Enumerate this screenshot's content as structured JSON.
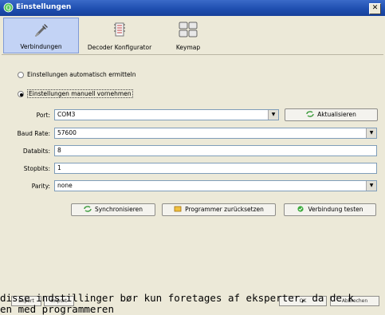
{
  "window": {
    "title": "Einstellungen",
    "close_glyph": "✕"
  },
  "toolbar": {
    "tabs": [
      {
        "label": "Verbindungen",
        "icon": "plug-icon",
        "active": true
      },
      {
        "label": "Decoder Konfigurator",
        "icon": "decoder-icon",
        "active": false
      },
      {
        "label": "Keymap",
        "icon": "keymap-icon",
        "active": false
      }
    ]
  },
  "connection": {
    "auto_label": "Einstellungen automatisch ermitteln",
    "manual_label": "Einstellungen manuell vornehmen",
    "selected": "manual"
  },
  "form": {
    "port_label": "Port:",
    "port_value": "COM3",
    "refresh_label": "Aktualisieren",
    "baud_label": "Baud Rate:",
    "baud_value": "57600",
    "databits_label": "Databits:",
    "databits_value": "8",
    "stopbits_label": "Stopbits:",
    "stopbits_value": "1",
    "parity_label": "Parity:",
    "parity_value": "none"
  },
  "actions": {
    "sync_label": "Synchronisieren",
    "reset_label": "Programmer zurücksetzen",
    "test_label": "Verbindung testen"
  },
  "footer": {
    "export_label": "Export",
    "import_label": "Import",
    "ok_label": "OK",
    "cancel_label": "Abbrechen"
  },
  "overlay_text": {
    "line1": "disse indstillinger bør kun foretages af eksperter, da de k",
    "line2": "en med programmeren"
  },
  "colors": {
    "titlebar": "#1f4fb0",
    "dialog_bg": "#ece9d8",
    "active_tab": "#c3d3f5",
    "field_border": "#7f9db9"
  }
}
